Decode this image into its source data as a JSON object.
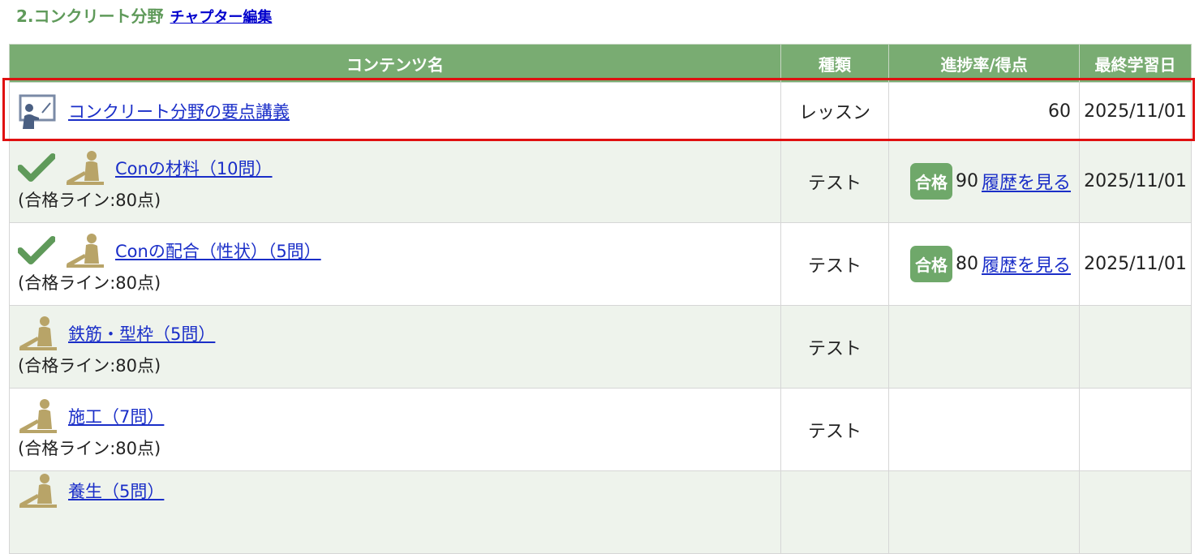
{
  "chapter": {
    "title": "2.コンクリート分野",
    "edit_label": "チャプター編集"
  },
  "table": {
    "headers": {
      "name": "コンテンツ名",
      "type": "種類",
      "progress": "進捗率/得点",
      "last_date": "最終学習日"
    },
    "rows": [
      {
        "name": "コンクリート分野の要点講義",
        "type": "レッスン",
        "progress": "60",
        "date": "2025/11/01"
      },
      {
        "name": "Conの材料（10問）",
        "sub": "(合格ライン:80点)",
        "type": "テスト",
        "badge": "合格",
        "score": "90",
        "history": "履歴を見る",
        "date": "2025/11/01"
      },
      {
        "name": "Conの配合（性状）（5問）",
        "sub": "(合格ライン:80点)",
        "type": "テスト",
        "badge": "合格",
        "score": "80",
        "history": "履歴を見る",
        "date": "2025/11/01"
      },
      {
        "name": "鉄筋・型枠（5問）",
        "sub": "(合格ライン:80点)",
        "type": "テスト"
      },
      {
        "name": "施工（7問）",
        "sub": "(合格ライン:80点)",
        "type": "テスト"
      },
      {
        "name": "養生（5問）"
      }
    ]
  },
  "icons": {
    "lesson": "lecture-board-icon",
    "completed": "checkmark-icon",
    "test": "person-studying-icon"
  },
  "colors": {
    "header_bg": "#79ac72",
    "chapter_title": "#5f9a5a",
    "pass_badge": "#6fa86a",
    "link": "#1a2ec8",
    "highlight": "#e01010"
  }
}
